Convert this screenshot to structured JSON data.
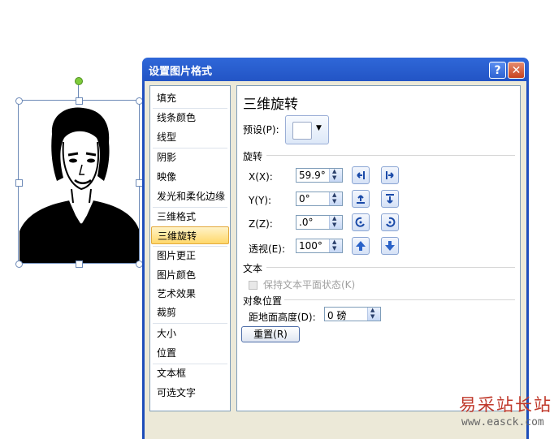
{
  "dialog": {
    "title": "设置图片格式",
    "help_glyph": "?",
    "close_glyph": "✕"
  },
  "nav": {
    "items": [
      {
        "label": "填充"
      },
      {
        "label": "线条颜色"
      },
      {
        "label": "线型"
      },
      {
        "label": "阴影"
      },
      {
        "label": "映像"
      },
      {
        "label": "发光和柔化边缘"
      },
      {
        "label": "三维格式"
      },
      {
        "label": "三维旋转",
        "selected": true
      },
      {
        "label": "图片更正"
      },
      {
        "label": "图片颜色"
      },
      {
        "label": "艺术效果"
      },
      {
        "label": "裁剪"
      },
      {
        "label": "大小"
      },
      {
        "label": "位置"
      },
      {
        "label": "文本框"
      },
      {
        "label": "可选文字"
      }
    ]
  },
  "panel": {
    "title": "三维旋转",
    "preset_label": "预设(P):",
    "rotation_header": "旋转",
    "x_label": "X(X):",
    "x_value": "59.9°",
    "y_label": "Y(Y):",
    "y_value": "0°",
    "z_label": "Z(Z):",
    "z_value": ".0°",
    "perspective_label": "透视(E):",
    "perspective_value": "100°",
    "text_header": "文本",
    "keep_text_flat_label": "保持文本平面状态(K)",
    "object_position_header": "对象位置",
    "distance_label": "距地面高度(D):",
    "distance_value": "0 磅",
    "reset_label": "重置(R)"
  },
  "icons": {
    "x_left": "rotate-x-left-icon",
    "x_right": "rotate-x-right-icon",
    "y_up": "rotate-y-up-icon",
    "y_down": "rotate-y-down-icon",
    "z_ccw": "rotate-z-counterclockwise-icon",
    "z_cw": "rotate-z-clockwise-icon",
    "persp_narrow": "perspective-narrow-icon",
    "persp_widen": "perspective-widen-icon"
  },
  "watermark": {
    "brand": "易采站长站",
    "url": "www.easck.com"
  },
  "colors": {
    "title_bar": "#1f4fbf",
    "selected_nav": "#ffd86b",
    "watermark_red": "#c0392b"
  }
}
